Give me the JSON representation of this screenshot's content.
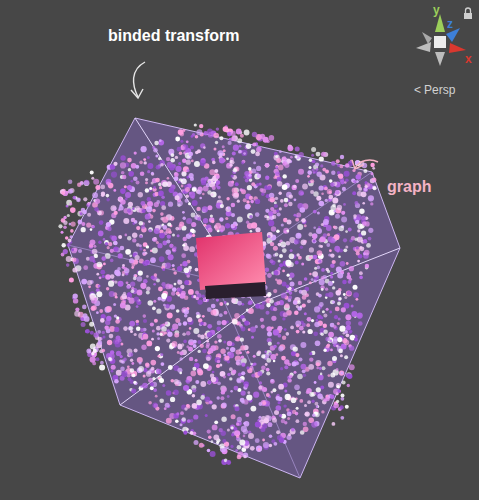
{
  "annotations": [
    {
      "text": "binded transform",
      "color": "#ffffff"
    },
    {
      "text": "graph",
      "color": "#f4b3c5"
    }
  ],
  "gizmo": {
    "axes": [
      {
        "label": "y",
        "color": "#9ccf5a"
      },
      {
        "label": "z",
        "color": "#3d7fd8"
      },
      {
        "label": "x",
        "color": "#d9382f"
      }
    ]
  },
  "view": {
    "icon": "<",
    "projection": "Persp"
  }
}
